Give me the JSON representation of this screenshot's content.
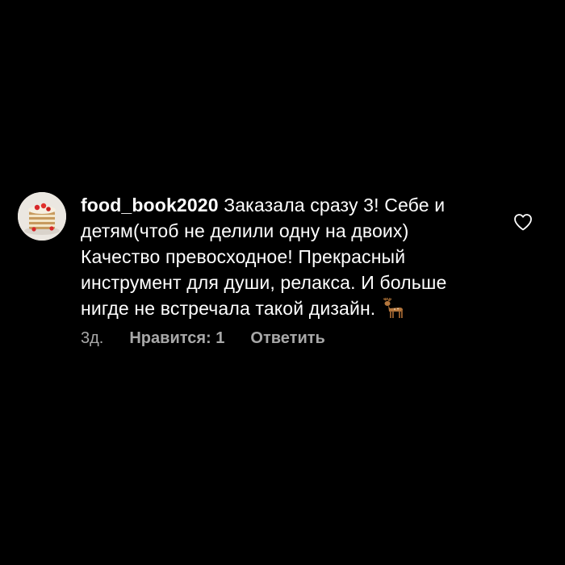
{
  "comment": {
    "username": "food_book2020",
    "text": "Заказала сразу 3! Себе и детям(чтоб не делили одну на двоих) Качество превосходное! Прекрасный инструмент для души, релакса. И больше нигде не встречала такой дизайн.",
    "emoji": "deer-emoji",
    "age": "3д.",
    "likes_label": "Нравится: 1",
    "reply_label": "Ответить"
  },
  "icons": {
    "like": "heart-outline-icon",
    "avatar": "avatar-cake-photo"
  },
  "colors": {
    "background": "#000000",
    "text": "#ffffff",
    "meta": "#a8a8a8"
  }
}
